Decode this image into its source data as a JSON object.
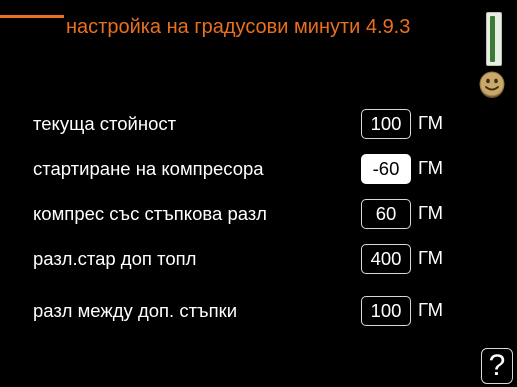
{
  "header": {
    "title": "настройка на градусови минути 4.9.3"
  },
  "icons": {
    "scroll": "scroll-indicator-icon",
    "smiley": "smiley-icon",
    "help": "help-icon"
  },
  "colors": {
    "accent": "#e8701f",
    "background": "#000000",
    "text": "#ffffff",
    "selected_bg": "#ffffff",
    "scroll_green": "#3c7a35"
  },
  "rows": [
    {
      "label": "текуща стойност",
      "value": "100",
      "unit": "ГМ",
      "selected": false
    },
    {
      "label": "стартиране на компресора",
      "value": "-60",
      "unit": "ГМ",
      "selected": true
    },
    {
      "label": "компрес със стъпкова разл",
      "value": "60",
      "unit": "ГМ",
      "selected": false
    },
    {
      "label": "разл.стар доп топл",
      "value": "400",
      "unit": "ГМ",
      "selected": false
    },
    {
      "label": "разл между доп. стъпки",
      "value": "100",
      "unit": "ГМ",
      "selected": false
    }
  ],
  "help": {
    "label": "?"
  }
}
